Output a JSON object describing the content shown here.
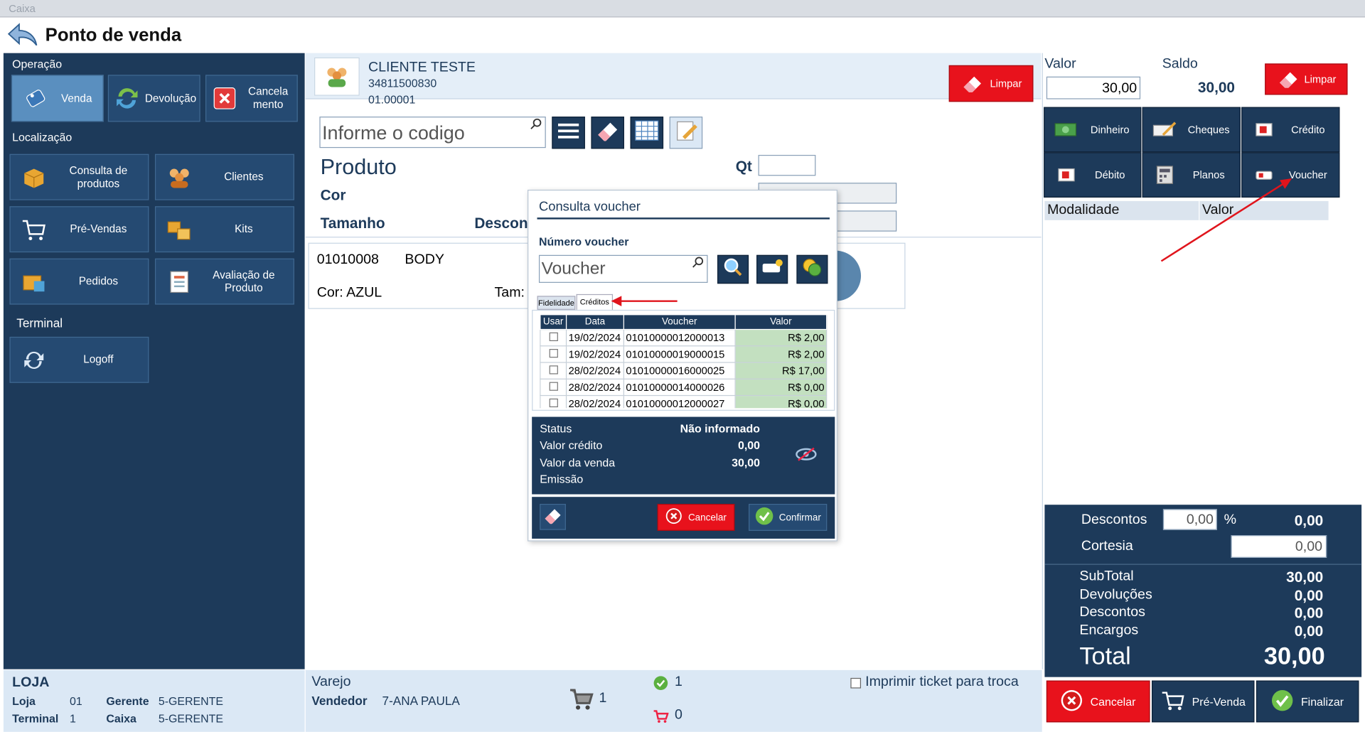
{
  "window": {
    "title": "Caixa"
  },
  "header": {
    "title": "Ponto de venda"
  },
  "sidebar": {
    "operacao_label": "Operação",
    "operacao": [
      {
        "label": "Venda"
      },
      {
        "label": "Devolução"
      },
      {
        "label": "Cancela mento"
      }
    ],
    "localizacao_label": "Localização",
    "localizacao": [
      {
        "label": "Consulta de produtos"
      },
      {
        "label": "Clientes"
      },
      {
        "label": "Pré-Vendas"
      },
      {
        "label": "Kits"
      },
      {
        "label": "Pedidos"
      },
      {
        "label": "Avaliação de Produto"
      }
    ],
    "terminal_label": "Terminal",
    "terminal": [
      {
        "label": "Logoff"
      }
    ]
  },
  "store": {
    "title": "LOJA",
    "loja_label": "Loja",
    "loja_value": "01",
    "gerente_label": "Gerente",
    "gerente_value": "5-GERENTE",
    "terminal_label": "Terminal",
    "terminal_value": "1",
    "caixa_label": "Caixa",
    "caixa_value": "5-GERENTE"
  },
  "customer": {
    "name": "CLIENTE TESTE",
    "doc": "34811500830",
    "code": "01.00001",
    "clear_label": "Limpar"
  },
  "product_entry": {
    "search_placeholder": "Informe o codigo",
    "produto_label": "Produto",
    "qt_label": "Qt",
    "cor_label": "Cor",
    "tamanho_label": "Tamanho",
    "desconto_label": "Descon"
  },
  "item": {
    "code": "01010008",
    "name": "BODY",
    "cor": "Cor: AZUL",
    "tam": "Tam:"
  },
  "payment": {
    "valor_label": "Valor",
    "valor_value": "30,00",
    "saldo_label": "Saldo",
    "saldo_value": "30,00",
    "clear_label": "Limpar",
    "methods": [
      {
        "label": "Dinheiro"
      },
      {
        "label": "Cheques"
      },
      {
        "label": "Crédito"
      },
      {
        "label": "Débito"
      },
      {
        "label": "Planos"
      },
      {
        "label": "Voucher"
      }
    ],
    "table_headers": [
      "Modalidade",
      "Valor"
    ]
  },
  "totals": {
    "descontos_label": "Descontos",
    "descontos_pct": "0,00",
    "pct_symbol": "%",
    "descontos_value": "0,00",
    "cortesia_label": "Cortesia",
    "cortesia_value": "0,00",
    "subtotal_label": "SubTotal",
    "subtotal_value": "30,00",
    "devolucoes_label": "Devoluções",
    "devolucoes_value": "0,00",
    "descontos2_label": "Descontos",
    "descontos2_value": "0,00",
    "encargos_label": "Encargos",
    "encargos_value": "0,00",
    "total_label": "Total",
    "total_value": "30,00"
  },
  "footer": {
    "cancelar": "Cancelar",
    "pre_venda": "Pré-Venda",
    "finalizar": "Finalizar",
    "varejo": "Varejo",
    "vendedor_label": "Vendedor",
    "vendedor_value": "7-ANA PAULA",
    "cart_count": "1",
    "ok_count": "1",
    "cart2_count": "0",
    "imprimir_label": "Imprimir ticket para troca"
  },
  "voucher_modal": {
    "title": "Consulta voucher",
    "numero_label": "Número voucher",
    "voucher_placeholder": "Voucher",
    "tabs": [
      "Fidelidade",
      "Créditos"
    ],
    "headers": [
      "Usar",
      "Data",
      "Voucher",
      "Valor"
    ],
    "rows": [
      {
        "data": "19/02/2024",
        "voucher": "01010000012000013",
        "valor": "R$ 2,00"
      },
      {
        "data": "19/02/2024",
        "voucher": "01010000019000015",
        "valor": "R$ 2,00"
      },
      {
        "data": "28/02/2024",
        "voucher": "01010000016000025",
        "valor": "R$ 17,00"
      },
      {
        "data": "28/02/2024",
        "voucher": "01010000014000026",
        "valor": "R$ 0,00"
      },
      {
        "data": "28/02/2024",
        "voucher": "01010000012000027",
        "valor": "R$ 0,00"
      }
    ],
    "status_label": "Status",
    "status_value": "Não informado",
    "valor_credito_label": "Valor crédito",
    "valor_credito_value": "0,00",
    "valor_venda_label": "Valor da venda",
    "valor_venda_value": "30,00",
    "emissao_label": "Emissão",
    "cancelar": "Cancelar",
    "confirmar": "Confirmar"
  },
  "colors": {
    "navy": "#1d3a5a",
    "red": "#e8121c",
    "annotation": "#e0141c",
    "light": "#dbe8f5"
  }
}
